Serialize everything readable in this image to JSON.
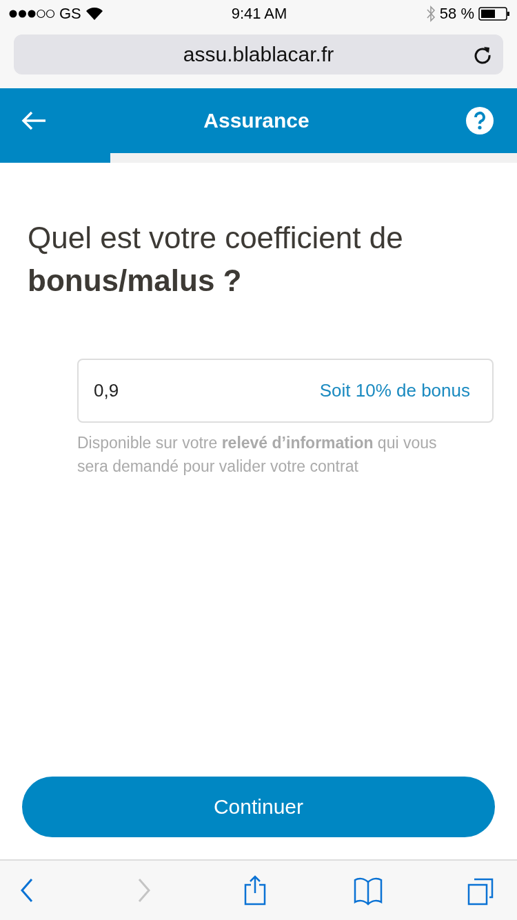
{
  "status_bar": {
    "carrier": "GS",
    "time": "9:41 AM",
    "battery": "58 %"
  },
  "browser": {
    "url": "assu.blablacar.fr"
  },
  "header": {
    "title": "Assurance"
  },
  "progress": {
    "level": 0.213
  },
  "question": "Quel est votre coefficient de **bonus/malus ?**",
  "field": {
    "value": "0,9",
    "suffix": "Soit 10% de bonus"
  },
  "help": "Disponible sur votre **relevé d’information** qui vous sera demandé pour valider votre contrat",
  "button": {
    "label": "Continuer"
  },
  "toolbar": [
    {
      "kind": "back",
      "disabled": false
    },
    {
      "kind": "forward",
      "disabled": true
    },
    {
      "kind": "share",
      "disabled": false
    },
    {
      "kind": "bookmarks",
      "disabled": false
    },
    {
      "kind": "tabs",
      "disabled": false
    }
  ]
}
